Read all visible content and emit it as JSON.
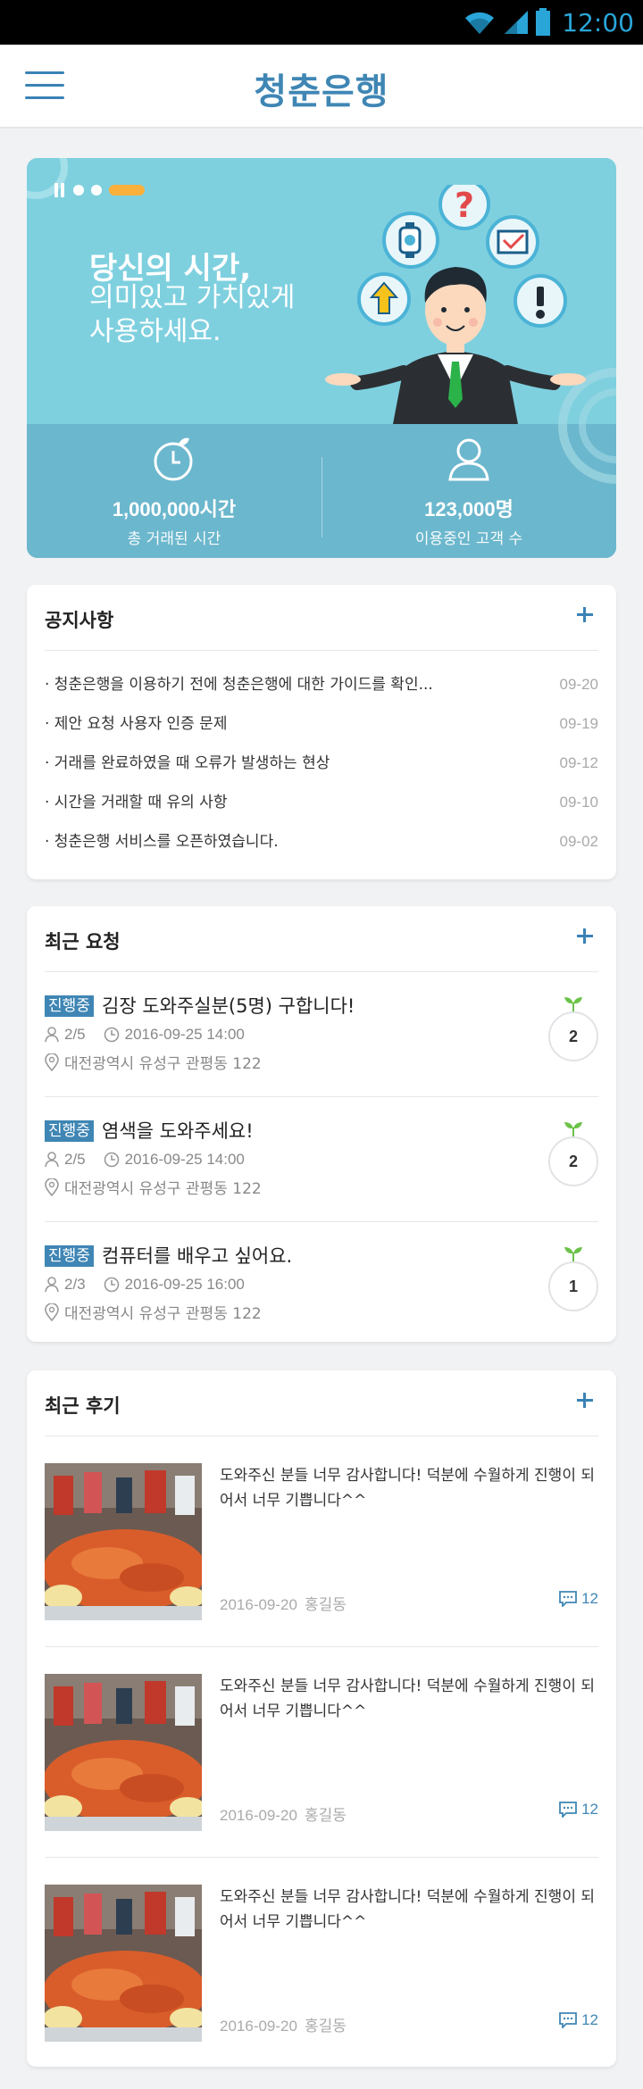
{
  "status_bar": {
    "time": "12:00",
    "icons": [
      "wifi-icon",
      "signal-icon",
      "battery-icon"
    ]
  },
  "header": {
    "title": "청춘은행",
    "menu_icon": "hamburger-icon"
  },
  "hero": {
    "title": "당신의 시간,",
    "subtitle_line1": "의미있고 가치있게",
    "subtitle_line2": "사용하세요.",
    "slide_count": 3,
    "stats": [
      {
        "icon": "timer-icon",
        "value": "1,000,000시간",
        "label": "총 거래된 시간"
      },
      {
        "icon": "user-icon",
        "value": "123,000명",
        "label": "이용중인 고객 수"
      }
    ]
  },
  "notices": {
    "title": "공지사항",
    "items": [
      {
        "text": "· 청춘은행을 이용하기 전에  청춘은행에 대한 가이드를 확인...",
        "date": "09-20"
      },
      {
        "text": "· 제안 요청 사용자 인증 문제",
        "date": "09-19"
      },
      {
        "text": "· 거래를 완료하였을 때 오류가 발생하는 현상",
        "date": "09-12"
      },
      {
        "text": "· 시간을 거래할 때 유의 사항",
        "date": "09-10"
      },
      {
        "text": "· 청춘은행 서비스를 오픈하였습니다.",
        "date": "09-02"
      }
    ]
  },
  "requests": {
    "title": "최근 요청",
    "items": [
      {
        "status": "진행중",
        "title": "김장 도와주실분(5명) 구합니다!",
        "people": "2/5",
        "datetime": "2016-09-25 14:00",
        "location": "대전광역시 유성구 관평동 122",
        "badge": "2"
      },
      {
        "status": "진행중",
        "title": "염색을 도와주세요!",
        "people": "2/5",
        "datetime": "2016-09-25 14:00",
        "location": "대전광역시 유성구 관평동 122",
        "badge": "2"
      },
      {
        "status": "진행중",
        "title": "컴퓨터를 배우고 싶어요.",
        "people": "2/3",
        "datetime": "2016-09-25 16:00",
        "location": "대전광역시 유성구 관평동 122",
        "badge": "1"
      }
    ]
  },
  "reviews": {
    "title": "최근 후기",
    "items": [
      {
        "text": "도와주신 분들 너무 감사합니다! 덕분에 수월하게 진행이 되어서 너무 기쁩니다^^",
        "date": "2016-09-20",
        "author": "홍길동",
        "comments": "12"
      },
      {
        "text": "도와주신 분들 너무 감사합니다! 덕분에 수월하게 진행이 되어서 너무 기쁩니다^^",
        "date": "2016-09-20",
        "author": "홍길동",
        "comments": "12"
      },
      {
        "text": "도와주신 분들 너무 감사합니다! 덕분에 수월하게 진행이 되어서 너무 기쁩니다^^",
        "date": "2016-09-20",
        "author": "홍길동",
        "comments": "12"
      }
    ]
  },
  "colors": {
    "brand": "#3f86b4",
    "hero_top": "#7fd0df",
    "hero_bottom": "#6bb7cd",
    "accent": "#fbb03b",
    "leaf": "#6cc24a"
  }
}
